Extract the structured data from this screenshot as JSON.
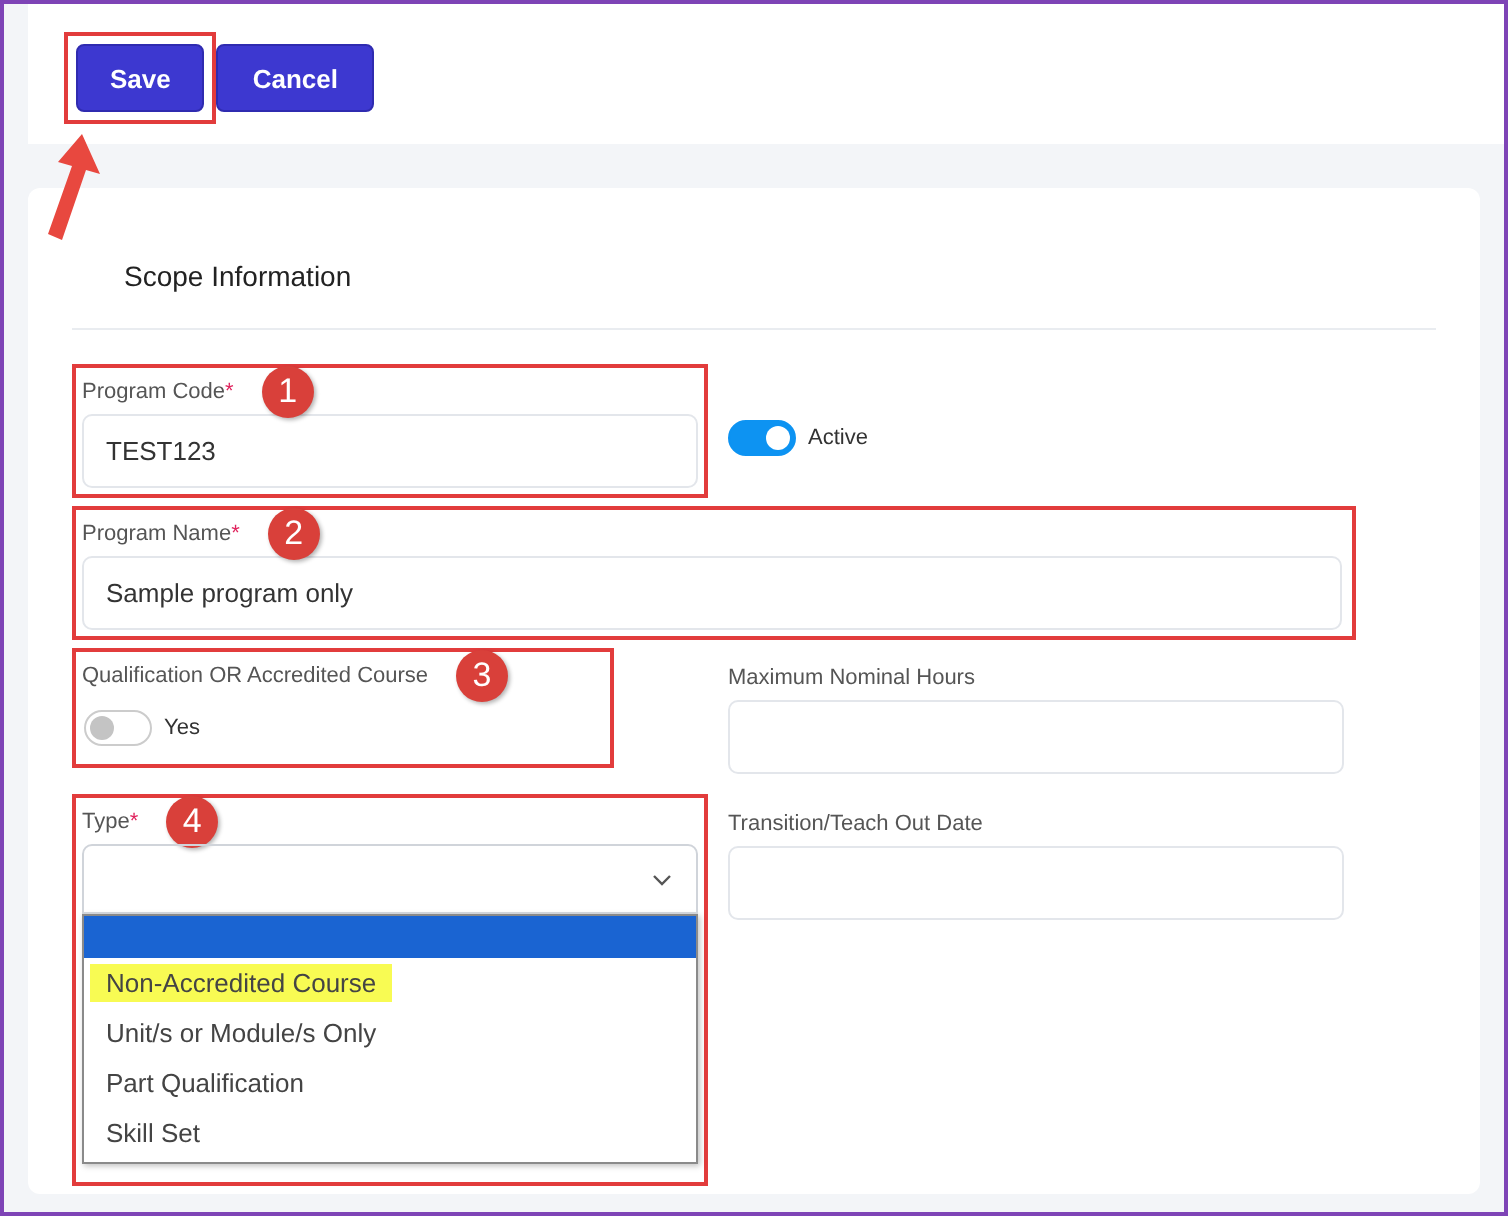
{
  "toolbar": {
    "buttons": [
      {
        "label": "Save",
        "annotated": true
      },
      {
        "label": "Cancel",
        "annotated": false
      }
    ]
  },
  "section": {
    "title": "Scope Information",
    "rows": [
      [
        {
          "kind": "text",
          "label": "Program Code",
          "required_mark": "*",
          "value": "TEST123",
          "callout": "1"
        },
        {
          "kind": "switch",
          "label": "Active",
          "on": true
        }
      ],
      [
        {
          "kind": "text",
          "label": "Program Name",
          "required_mark": "*",
          "value": "Sample program only",
          "callout": "2"
        }
      ],
      [
        {
          "kind": "toggle",
          "label": "Qualification OR Accredited Course",
          "toggle_label": "Yes",
          "on": false,
          "callout": "3"
        },
        {
          "kind": "text",
          "label": "Maximum Nominal Hours"
        }
      ],
      [
        {
          "kind": "select",
          "label": "Type",
          "required_mark": "*",
          "callout": "4",
          "expanded": true,
          "options": [
            {
              "selected": true,
              "highlighted": false
            },
            {
              "label": "Non-Accredited Course",
              "selected": false,
              "highlighted": true
            },
            {
              "label": "Unit/s or Module/s Only",
              "selected": false,
              "highlighted": false
            },
            {
              "label": "Part Qualification",
              "selected": false,
              "highlighted": false
            },
            {
              "label": "Skill Set",
              "selected": false,
              "highlighted": false
            }
          ]
        },
        {
          "kind": "text",
          "label": "Transition/Teach Out Date"
        }
      ]
    ]
  }
}
